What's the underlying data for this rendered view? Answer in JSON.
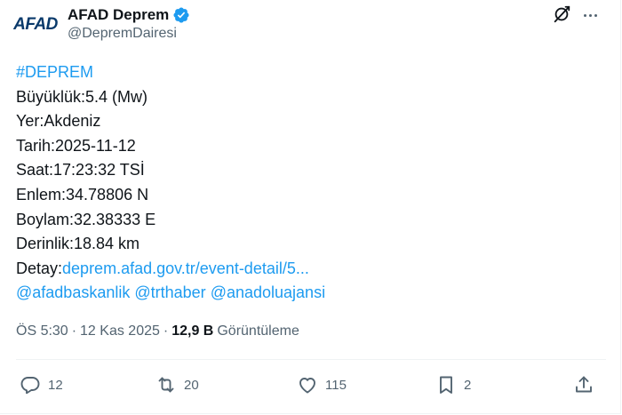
{
  "author": {
    "avatar_text": "AFAD",
    "display_name": "AFAD Deprem",
    "handle": "@DepremDairesi"
  },
  "tweet": {
    "hashtag": "#DEPREM",
    "magnitude": "Büyüklük:5.4 (Mw)",
    "location": "Yer:Akdeniz",
    "date": "Tarih:2025-11-12",
    "time": "Saat:17:23:32 TSİ",
    "latitude": "Enlem:34.78806 N",
    "longitude": "Boylam:32.38333 E",
    "depth": "Derinlik:18.84 km",
    "detail_label": "Detay:",
    "detail_link": "deprem.afad.gov.tr/event-detail/5...",
    "mention_1": "@afadbaskanlik",
    "mention_2": "@trthaber",
    "mention_3": "@anadoluajansi"
  },
  "meta": {
    "time": "ÖS 5:30",
    "separator": "·",
    "date": "12 Kas 2025",
    "views_count": "12,9 B",
    "views_label": "Görüntüleme"
  },
  "actions": {
    "replies": "12",
    "reposts": "20",
    "likes": "115",
    "bookmarks": "2"
  },
  "colors": {
    "link": "#1d9bf0",
    "verified": "#1d9bf0",
    "secondary_text": "#536471",
    "primary_text": "#0f1419"
  },
  "icons": [
    "verified-badge-icon",
    "grok-icon",
    "more-icon",
    "reply-icon",
    "repost-icon",
    "like-icon",
    "bookmark-icon",
    "share-icon"
  ]
}
